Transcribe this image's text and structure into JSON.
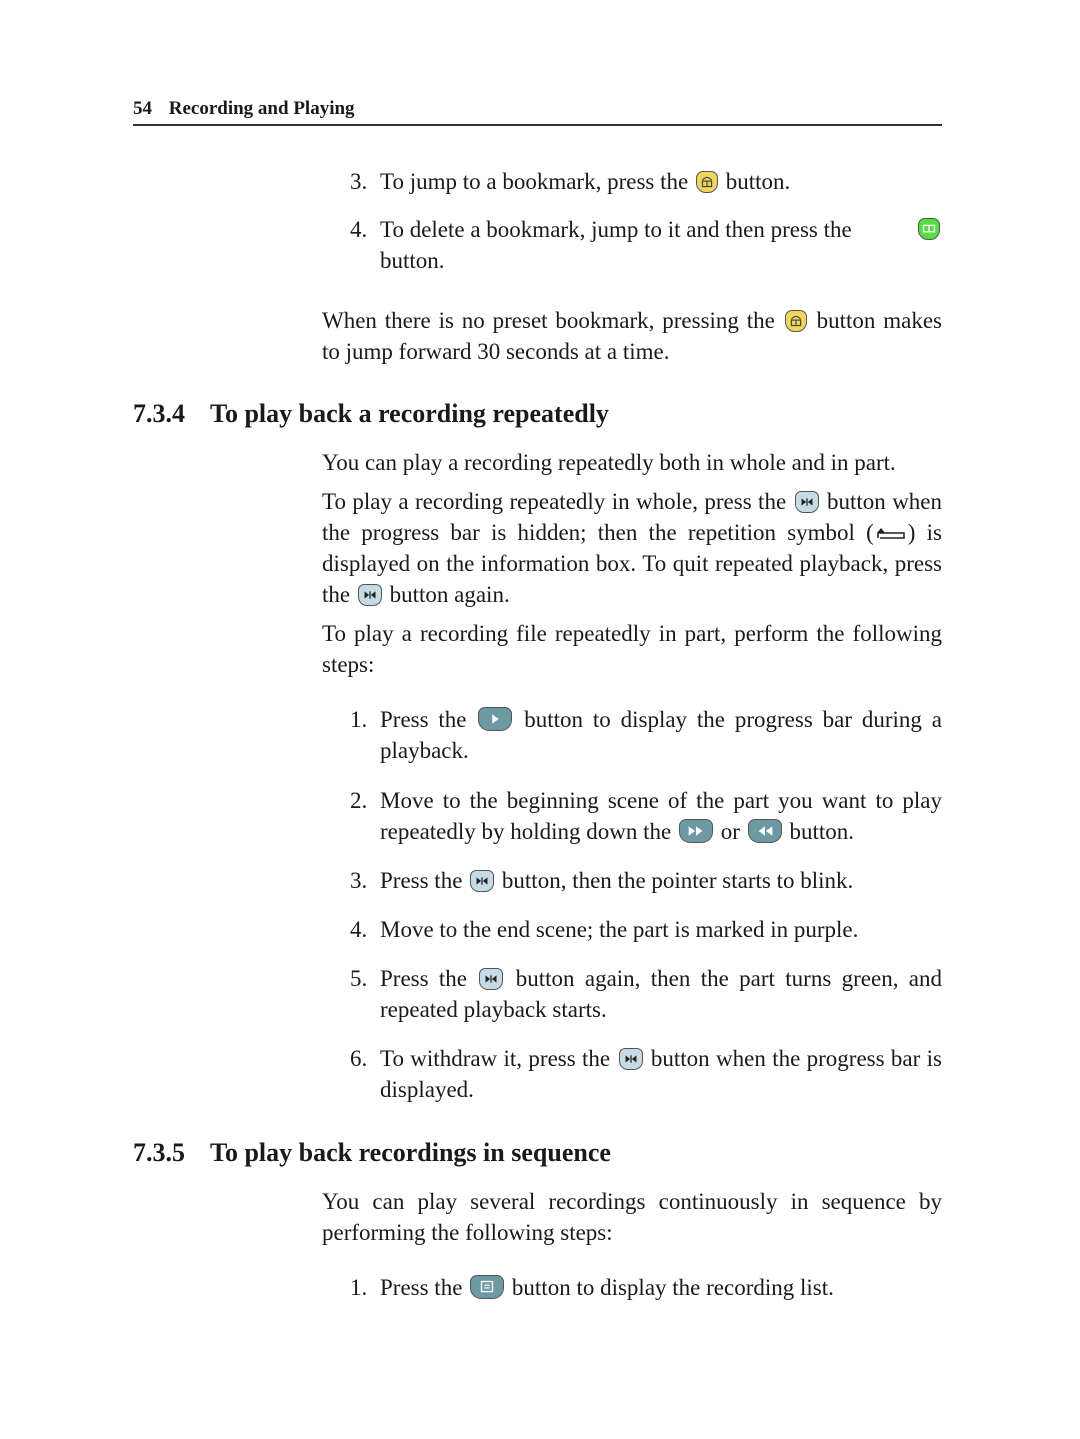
{
  "header": {
    "page_number": "54",
    "chapter": "Recording and Playing"
  },
  "intro_steps": [
    {
      "num": "3.",
      "before": "To jump to a bookmark, press the",
      "icon": "bookmark-jump-icon",
      "after": "button."
    },
    {
      "num": "4.",
      "before": "To delete a bookmark, jump to it and then press the",
      "icon": "bookmark-delete-icon",
      "after": "button."
    }
  ],
  "intro_para": {
    "before": "When there is no preset bookmark, pressing the",
    "icon": "bookmark-jump-icon",
    "after": "button makes to jump forward 30 seconds at a time."
  },
  "section_734": {
    "number": "7.3.4",
    "title": "To play back a recording repeatedly",
    "p1": "You can play a recording repeatedly both in whole and in part.",
    "p2_a": "To play a recording repeatedly in whole, press the",
    "p2_b": "button when the progress bar is hidden; then the repetition symbol (",
    "p2_c": ") is displayed on the information box.  To quit repeated playback, press the",
    "p2_d": "button again.",
    "p3": "To play a recording file repeatedly in part, perform the following steps:",
    "steps": [
      {
        "num": "1.",
        "a": "Press the",
        "b": "button to display the progress bar during a playback."
      },
      {
        "num": "2.",
        "a": "Move to the beginning scene of the part you want to play repeatedly by holding down the",
        "b": "or",
        "c": "button."
      },
      {
        "num": "3.",
        "a": "Press the",
        "b": "button, then the pointer starts to blink."
      },
      {
        "num": "4.",
        "a": "Move to the end scene; the part is marked in purple."
      },
      {
        "num": "5.",
        "a": "Press the",
        "b": "button again, then the part turns green, and repeated playback starts."
      },
      {
        "num": "6.",
        "a": "To withdraw it, press the",
        "b": "button when the progress bar is displayed."
      }
    ]
  },
  "section_735": {
    "number": "7.3.5",
    "title": "To play back recordings in sequence",
    "p1": "You can play several recordings continuously in sequence by performing the following steps:",
    "steps": [
      {
        "num": "1.",
        "a": "Press the",
        "b": "button to display the recording list."
      }
    ]
  },
  "colors": {
    "bookmark_yellow": "#f2d65c",
    "bookmark_green": "#55dd44",
    "repeat_button": "#c6dbe3",
    "nav_button": "#6d99a2"
  }
}
